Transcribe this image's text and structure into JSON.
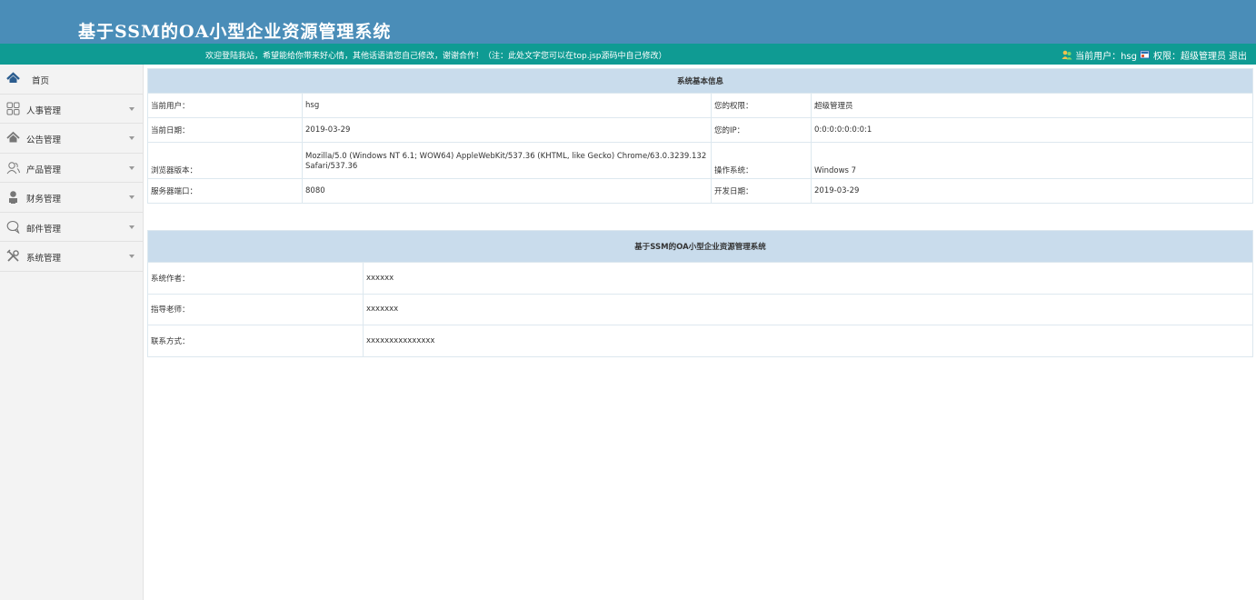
{
  "header": {
    "title": "基于SSM的OA小型企业资源管理系统"
  },
  "topbar": {
    "welcome": "欢迎登陆我站，希望能给你带来好心情，其他话语请您自己修改，谢谢合作！（注：此处文字您可以在top.jsp源码中自己修改）",
    "current_user": "当前用户：hsg",
    "role": "权限：超级管理员",
    "logout": "退出"
  },
  "sidebar": {
    "items": [
      {
        "label": "首页",
        "icon": "home-icon"
      },
      {
        "label": "人事管理",
        "icon": "grid-icon"
      },
      {
        "label": "公告管理",
        "icon": "house-icon"
      },
      {
        "label": "产品管理",
        "icon": "users-icon"
      },
      {
        "label": "财务管理",
        "icon": "person-icon"
      },
      {
        "label": "邮件管理",
        "icon": "chat-icon"
      },
      {
        "label": "系统管理",
        "icon": "tools-icon"
      }
    ]
  },
  "sysinfo": {
    "caption": "系统基本信息",
    "rows": [
      {
        "l1": "当前用户：",
        "v1": "hsg",
        "l2": "您的权限：",
        "v2": "超级管理员"
      },
      {
        "l1": "当前日期：",
        "v1": "2019-03-29",
        "l2": "您的IP：",
        "v2": "0:0:0:0:0:0:0:1"
      },
      {
        "l1": "浏览器版本：",
        "v1": "Mozilla/5.0 (Windows NT 6.1; WOW64) AppleWebKit/537.36 (KHTML, like Gecko) Chrome/63.0.3239.132 Safari/537.36",
        "l2": "操作系统：",
        "v2": "Windows 7"
      },
      {
        "l1": "服务器端口：",
        "v1": "8080",
        "l2": "开发日期：",
        "v2": "2019-03-29"
      }
    ]
  },
  "about": {
    "caption": "基于SSM的OA小型企业资源管理系统",
    "rows": [
      {
        "label": "系统作者：",
        "value": "xxxxxx"
      },
      {
        "label": "指导老师：",
        "value": "xxxxxxx"
      },
      {
        "label": "联系方式：",
        "value": "xxxxxxxxxxxxxxx"
      }
    ]
  },
  "colors": {
    "header_bg": "#4a8db8",
    "topbar_bg": "#0f9b93",
    "caption_bg": "#c9dcec",
    "sidebar_bg": "#f3f3f3"
  }
}
